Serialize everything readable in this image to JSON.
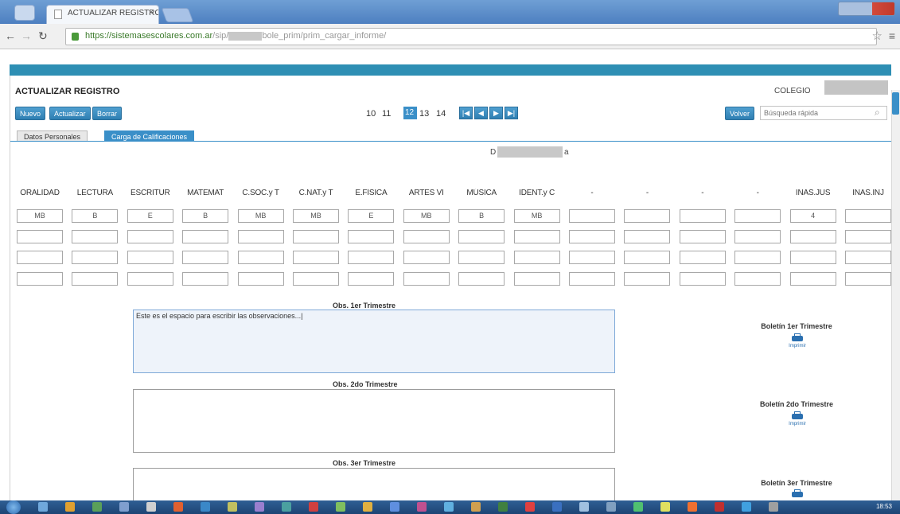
{
  "browser": {
    "tab_title": "ACTUALIZAR REGISTRO",
    "tab_close": "×",
    "url_host": "https://sistemasescolares.com.ar",
    "url_dim_prefix": "/sip/",
    "url_path": "bole_prim/prim_cargar_informe/"
  },
  "header": {
    "title": "ACTUALIZAR REGISTRO",
    "colegio_label": "COLEGIO"
  },
  "toolbar": {
    "nuevo": "Nuevo",
    "actualizar": "Actualizar",
    "borrar": "Borrar",
    "volver": "Volver",
    "search_placeholder": "Búsqueda rápida"
  },
  "pager": {
    "pages": [
      "10",
      "11",
      "12",
      "13",
      "14"
    ],
    "active": "12",
    "nav": [
      "|◀",
      "◀",
      "▶",
      "▶|"
    ]
  },
  "tabs": [
    "Datos Personales",
    "Carga de Calificaciones"
  ],
  "student": {
    "prefix": "D",
    "suffix": "a"
  },
  "grades": {
    "columns": [
      "ORALIDAD",
      "LECTURA",
      "ESCRITUR",
      "MATEMAT",
      "C.SOC.y T",
      "C.NAT.y T",
      "E.FÍSICA",
      "ARTES VI",
      "MÚSICA",
      "IDENT.y C",
      "-",
      "-",
      "-",
      "-",
      "INAS.JUS",
      "INAS.INJ"
    ],
    "rows": [
      [
        "MB",
        "B",
        "E",
        "B",
        "MB",
        "MB",
        "E",
        "MB",
        "B",
        "MB",
        "",
        "",
        "",
        "",
        "4",
        ""
      ],
      [
        "",
        "",
        "",
        "",
        "",
        "",
        "",
        "",
        "",
        "",
        "",
        "",
        "",
        "",
        "",
        ""
      ],
      [
        "",
        "",
        "",
        "",
        "",
        "",
        "",
        "",
        "",
        "",
        "",
        "",
        "",
        "",
        "",
        ""
      ],
      [
        "",
        "",
        "",
        "",
        "",
        "",
        "",
        "",
        "",
        "",
        "",
        "",
        "",
        "",
        "",
        ""
      ]
    ]
  },
  "observations": [
    {
      "label": "Obs. 1er Trimestre",
      "text": "Este es el espacio para escribir las observaciones...|"
    },
    {
      "label": "Obs. 2do Trimestre",
      "text": ""
    },
    {
      "label": "Obs. 3er Trimestre",
      "text": ""
    }
  ],
  "boletines": [
    {
      "label": "Boletín 1er Trimestre",
      "print": "Imprimir"
    },
    {
      "label": "Boletín 2do Trimestre",
      "print": "Imprimir"
    },
    {
      "label": "Boletín 3er Trimestre",
      "print": "Imprimir"
    }
  ],
  "taskbar": {
    "clock": "18:53"
  },
  "colors": {
    "accent": "#2e8fb4",
    "button": "#2f7fb2"
  }
}
